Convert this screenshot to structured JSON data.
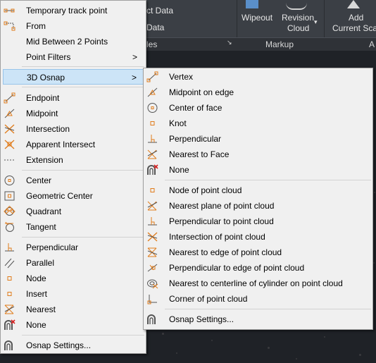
{
  "ribbon": {
    "data_label_1": "ct Data",
    "data_label_2": "Data",
    "panel_left": "les",
    "wipeout": "Wipeout",
    "revision_cloud_1": "Revision",
    "revision_cloud_2": "Cloud",
    "add_label_1": "Add",
    "add_label_2": "Current Sca",
    "markup_panel": "Markup",
    "panel_right": "A"
  },
  "main_menu": {
    "items": [
      {
        "label": "Temporary track point",
        "icon": "track-point-icon"
      },
      {
        "label": "From",
        "icon": "from-icon"
      },
      {
        "label": "Mid Between 2 Points",
        "icon": ""
      },
      {
        "label": "Point Filters",
        "icon": "",
        "arrow": ">"
      },
      {
        "label": "3D Osnap",
        "icon": "",
        "arrow": ">"
      },
      {
        "label": "Endpoint",
        "icon": "endpoint-icon"
      },
      {
        "label": "Midpoint",
        "icon": "midpoint-icon"
      },
      {
        "label": "Intersection",
        "icon": "intersection-icon"
      },
      {
        "label": "Apparent Intersect",
        "icon": "apparent-intersect-icon"
      },
      {
        "label": "Extension",
        "icon": "extension-icon"
      },
      {
        "label": "Center",
        "icon": "center-icon"
      },
      {
        "label": "Geometric Center",
        "icon": "geometric-center-icon"
      },
      {
        "label": "Quadrant",
        "icon": "quadrant-icon"
      },
      {
        "label": "Tangent",
        "icon": "tangent-icon"
      },
      {
        "label": "Perpendicular",
        "icon": "perpendicular-icon"
      },
      {
        "label": "Parallel",
        "icon": "parallel-icon"
      },
      {
        "label": "Node",
        "icon": "node-icon"
      },
      {
        "label": "Insert",
        "icon": "insert-icon"
      },
      {
        "label": "Nearest",
        "icon": "nearest-icon"
      },
      {
        "label": "None",
        "icon": "none-icon"
      },
      {
        "label": "Osnap Settings...",
        "icon": "osnap-settings-icon"
      }
    ]
  },
  "sub_menu": {
    "items": [
      {
        "label": "Vertex",
        "icon": "vertex-icon"
      },
      {
        "label": "Midpoint on edge",
        "icon": "midpoint-on-edge-icon"
      },
      {
        "label": "Center of face",
        "icon": "center-of-face-icon"
      },
      {
        "label": "Knot",
        "icon": "knot-icon"
      },
      {
        "label": "Perpendicular",
        "icon": "perpendicular-icon"
      },
      {
        "label": "Nearest to Face",
        "icon": "nearest-to-face-icon"
      },
      {
        "label": "None",
        "icon": "none-icon"
      },
      {
        "label": "Node of point cloud",
        "icon": "node-point-cloud-icon"
      },
      {
        "label": "Nearest plane of point cloud",
        "icon": "nearest-plane-icon"
      },
      {
        "label": "Perpendicular to point cloud",
        "icon": "perpendicular-point-cloud-icon"
      },
      {
        "label": "Intersection of point cloud",
        "icon": "intersection-point-cloud-icon"
      },
      {
        "label": "Nearest to edge of point cloud",
        "icon": "nearest-edge-icon"
      },
      {
        "label": "Perpendicular to edge of point cloud",
        "icon": "perpendicular-edge-icon"
      },
      {
        "label": "Nearest to centerline of cylinder on point cloud",
        "icon": "cylinder-centerline-icon"
      },
      {
        "label": "Corner of point cloud",
        "icon": "corner-point-cloud-icon"
      },
      {
        "label": "Osnap Settings...",
        "icon": "osnap-settings-icon"
      }
    ]
  },
  "colors": {
    "snap_orange": "#e07b1a",
    "highlight": "#91c9f7",
    "none_red": "#d62020"
  }
}
